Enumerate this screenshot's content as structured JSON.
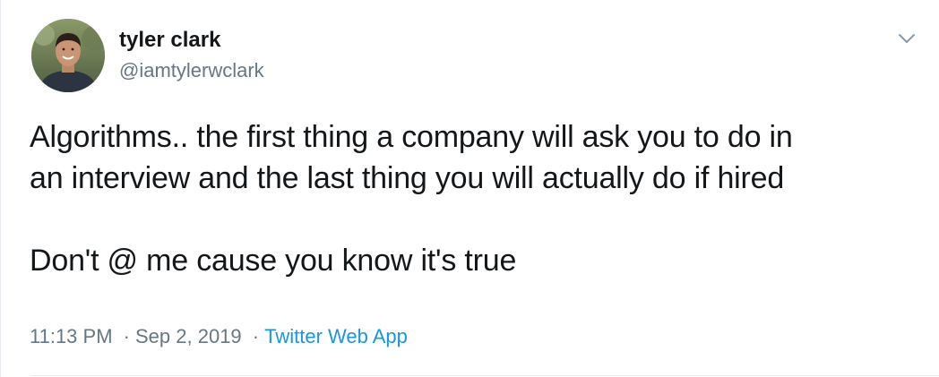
{
  "user": {
    "display_name": "tyler clark",
    "handle": "@iamtylerwclark",
    "avatar_icon": "user-avatar-photo"
  },
  "menu": {
    "icon": "chevron-down-icon"
  },
  "tweet": {
    "lines": [
      "Algorithms.. the first thing a company will ask you to do in",
      "an interview and the last thing you will actually do if hired",
      "",
      "Don't @ me cause you know it's true"
    ]
  },
  "meta": {
    "time": "11:13 PM",
    "separator": "·",
    "date": "Sep 2, 2019",
    "source": "Twitter Web App"
  },
  "colors": {
    "text": "#14171a",
    "secondary": "#657786",
    "link": "#1b95e0",
    "border": "#e6ecf0"
  }
}
